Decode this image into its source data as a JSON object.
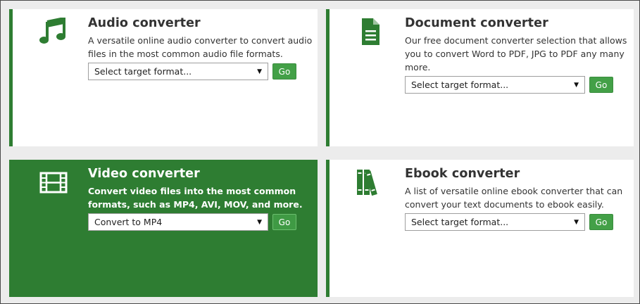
{
  "colors": {
    "brand_green": "#2e7d32",
    "button_green": "#43a047",
    "card_bg": "#ffffff",
    "page_bg": "#ececec"
  },
  "cards": [
    {
      "id": "audio",
      "icon": "music-note-icon",
      "title": "Audio converter",
      "description": "A versatile online audio converter to convert audio files in the most common audio file formats.",
      "select_value": "Select target format...",
      "button_label": "Go"
    },
    {
      "id": "document",
      "icon": "document-icon",
      "title": "Document converter",
      "description": "Our free document converter selection that allows you to convert Word to PDF, JPG to PDF any many more.",
      "select_value": "Select target format...",
      "button_label": "Go"
    },
    {
      "id": "video",
      "icon": "film-strip-icon",
      "title": "Video converter",
      "description": "Convert video files into the most common formats, such as MP4, AVI, MOV, and more.",
      "select_value": "Convert to MP4",
      "button_label": "Go",
      "active": true
    },
    {
      "id": "ebook",
      "icon": "books-icon",
      "title": "Ebook converter",
      "description": "A list of versatile online ebook converter that can convert your text documents to ebook easily.",
      "select_value": "Select target format...",
      "button_label": "Go"
    }
  ]
}
